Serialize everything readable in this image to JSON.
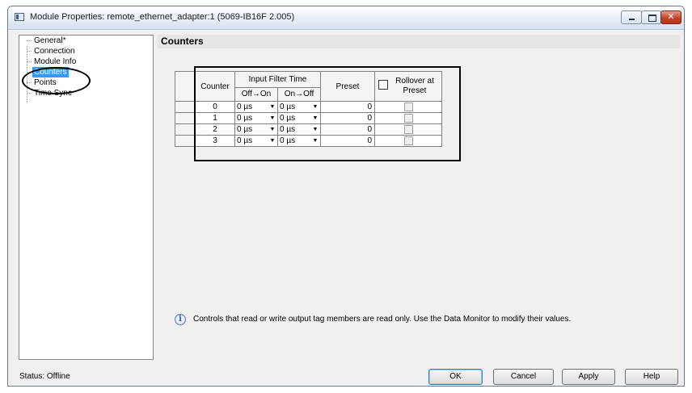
{
  "window": {
    "title": "Module Properties: remote_ethernet_adapter:1 (5069-IB16F 2.005)"
  },
  "tree": {
    "items": [
      {
        "label": "General*"
      },
      {
        "label": "Connection"
      },
      {
        "label": "Module Info"
      },
      {
        "label": "Counters",
        "selected": true
      },
      {
        "label": "Points"
      },
      {
        "label": "Time Sync"
      }
    ]
  },
  "section": {
    "title": "Counters"
  },
  "grid": {
    "headers": {
      "counter": "Counter",
      "input_filter_time": "Input Filter Time",
      "off_on": "Off→On",
      "on_off": "On→Off",
      "preset": "Preset",
      "rollover": "Rollover at Preset"
    },
    "rows": [
      {
        "counter": "0",
        "off_on": "0 µs",
        "on_off": "0 µs",
        "preset": "0"
      },
      {
        "counter": "1",
        "off_on": "0 µs",
        "on_off": "0 µs",
        "preset": "0"
      },
      {
        "counter": "2",
        "off_on": "0 µs",
        "on_off": "0 µs",
        "preset": "0"
      },
      {
        "counter": "3",
        "off_on": "0 µs",
        "on_off": "0 µs",
        "preset": "0"
      }
    ]
  },
  "info": {
    "text": "Controls that read or write output tag members are read only. Use the Data Monitor to modify their values."
  },
  "status": {
    "text": "Status:  Offline"
  },
  "buttons": {
    "ok": "OK",
    "cancel": "Cancel",
    "apply": "Apply",
    "help": "Help"
  },
  "colors": {
    "selection": "#3399ff",
    "window_bg": "#f0f0f0",
    "close_button": "#c4432b"
  }
}
